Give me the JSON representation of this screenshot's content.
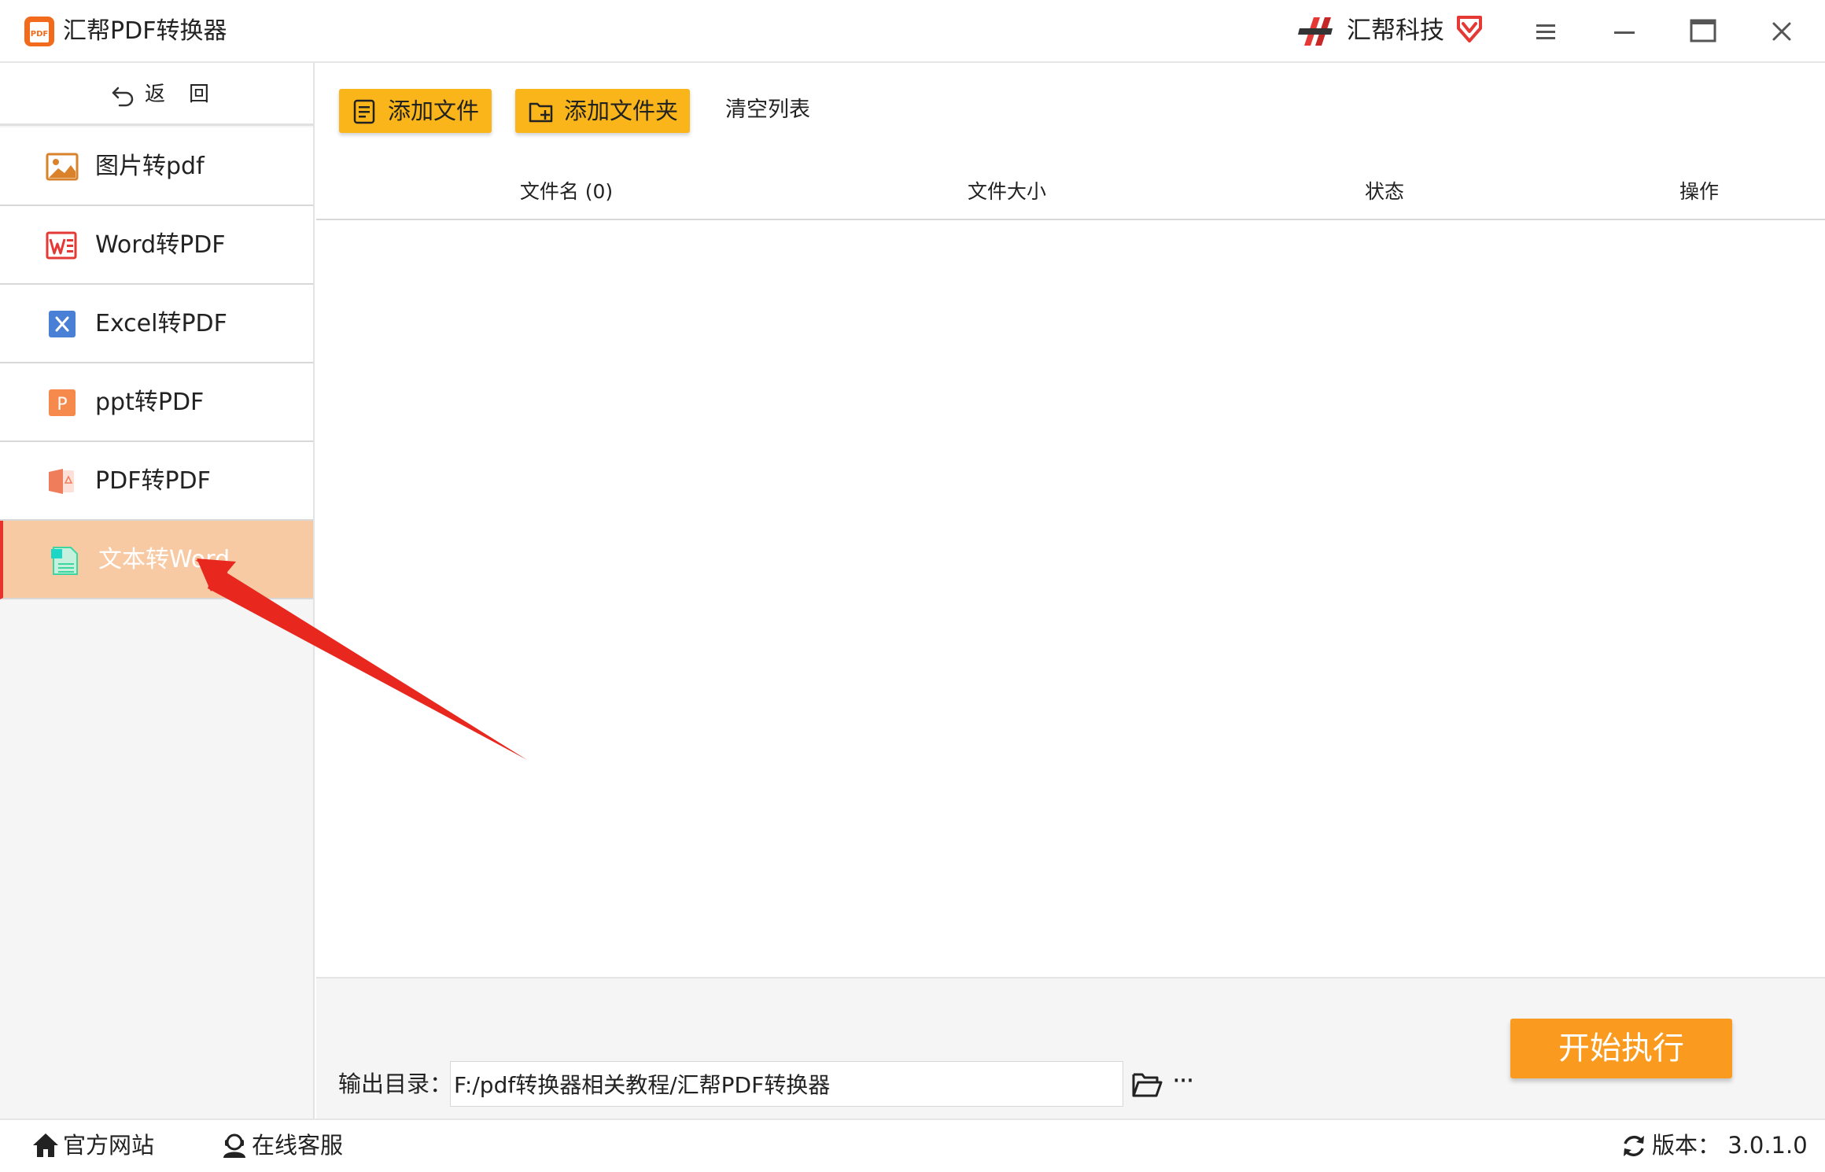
{
  "window": {
    "app_title": "汇帮PDF转换器",
    "brand_name": "汇帮科技",
    "accent_color": "#f9b51a",
    "primary_action_color": "#fa9a1e"
  },
  "sidebar": {
    "back_label": "返回",
    "items": [
      {
        "label": "图片转pdf",
        "icon": "image-icon"
      },
      {
        "label": "Word转PDF",
        "icon": "word-icon"
      },
      {
        "label": "Excel转PDF",
        "icon": "excel-icon"
      },
      {
        "label": "ppt转PDF",
        "icon": "ppt-icon"
      },
      {
        "label": "PDF转PDF",
        "icon": "pdf-icon"
      },
      {
        "label": "文本转Word",
        "icon": "text-file-icon",
        "active": true
      }
    ]
  },
  "toolbar": {
    "add_file": "添加文件",
    "add_folder": "添加文件夹",
    "clear_list": "清空列表"
  },
  "table": {
    "headers": [
      "文件名 (0)",
      "文件大小",
      "状态",
      "操作"
    ],
    "rows": []
  },
  "output": {
    "label": "输出目录：",
    "path": "F:/pdf转换器相关教程/汇帮PDF转换器",
    "more": "···"
  },
  "start_button": "开始执行",
  "footer": {
    "website": "官方网站",
    "support": "在线客服",
    "version": "版本：  3.0.1.0"
  }
}
